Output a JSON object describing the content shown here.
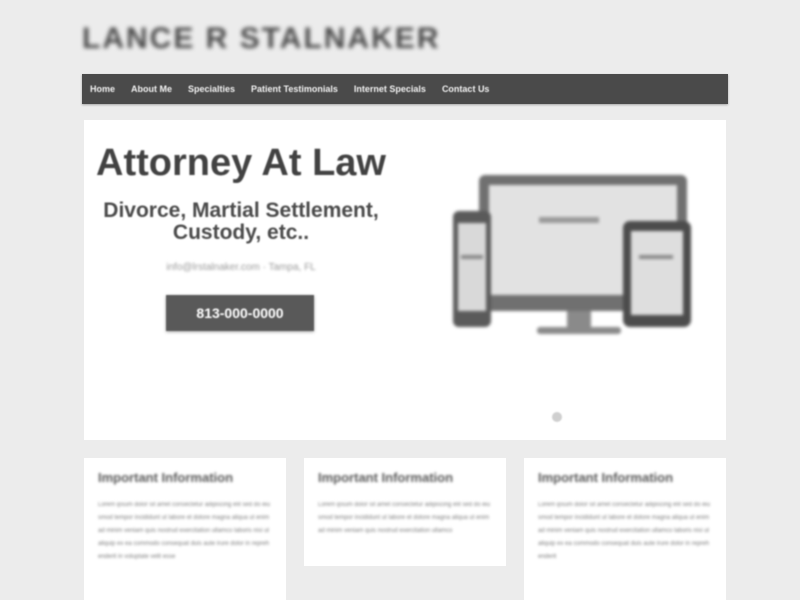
{
  "site": {
    "logo_text": "LANCE R STALNAKER"
  },
  "nav": {
    "items": [
      "Home",
      "About Me",
      "Specialties",
      "Patient Testimonials",
      "Internet Specials",
      "Contact Us"
    ]
  },
  "hero": {
    "title": "Attorney At Law",
    "subtitle": "Divorce, Martial Settlement, Custody, etc..",
    "contact_line": "info@lrstalnaker.com · Tampa, FL",
    "phone_button": "813-000-0000"
  },
  "cards": [
    {
      "heading": "Important Information",
      "body": "Lorem ipsum dolor sit amet consectetur adipiscing elit sed do eiusmod tempor incididunt ut labore et dolore magna aliqua ut enim ad minim veniam quis nostrud exercitation ullamco laboris nisi ut aliquip ex ea commodo consequat duis aute irure dolor in reprehenderit in voluptate velit esse"
    },
    {
      "heading": "Important Information",
      "body": "Lorem ipsum dolor sit amet consectetur adipiscing elit sed do eiusmod tempor incididunt ut labore et dolore magna aliqua ut enim ad minim veniam quis nostrud exercitation ullamco"
    },
    {
      "heading": "Important Information",
      "body": "Lorem ipsum dolor sit amet consectetur adipiscing elit sed do eiusmod tempor incididunt ut labore et dolore magna aliqua ut enim ad minim veniam quis nostrud exercitation ullamco laboris nisi ut aliquip ex ea commodo consequat duis aute irure dolor in reprehenderit"
    }
  ],
  "icons": {
    "hero_graphic": "responsive-devices-icon",
    "slider": "slider-dot-icon"
  },
  "colors": {
    "nav_background": "#4a4a4a",
    "button_background": "#595959",
    "page_background": "#ececec"
  }
}
